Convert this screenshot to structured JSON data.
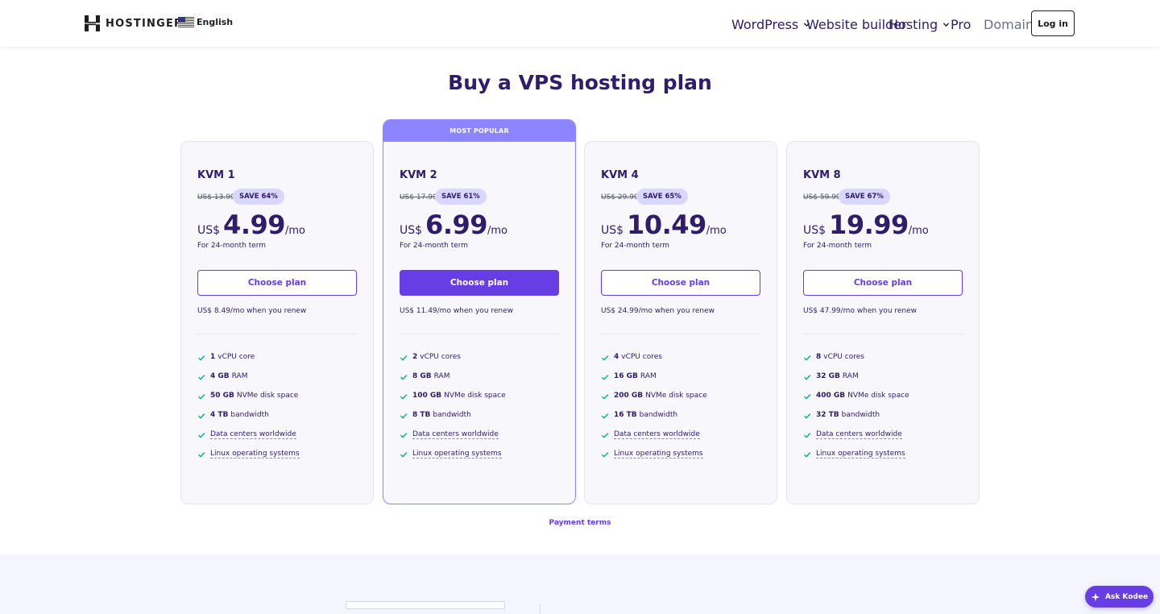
{
  "header": {
    "logo_text": "HOSTINGER",
    "language": "English",
    "nav": [
      {
        "label": "WordPress"
      },
      {
        "label": "Website builder"
      },
      {
        "label": "Hosting"
      },
      {
        "label": "Pro"
      },
      {
        "label": "Domains"
      }
    ],
    "login_label": "Log in"
  },
  "page_title": "Buy a VPS hosting plan",
  "popular_label": "MOST POPULAR",
  "plans": [
    {
      "name": "KVM 1",
      "old_price": "US$ 13.99",
      "save": "SAVE 64%",
      "currency": "US$",
      "price": "4.99",
      "per": "/mo",
      "term": "For 24-month term",
      "button": "Choose plan",
      "renew": "US$ 8.49/mo when you renew",
      "features": [
        {
          "bold": "1",
          "text": "vCPU core"
        },
        {
          "bold": "4 GB",
          "text": "RAM"
        },
        {
          "bold": "50 GB",
          "text": "NVMe disk space"
        },
        {
          "bold": "4 TB",
          "text": "bandwidth"
        },
        {
          "bold": "",
          "text": "Data centers worldwide"
        },
        {
          "bold": "",
          "text": "Linux operating systems"
        }
      ]
    },
    {
      "name": "KVM 2",
      "old_price": "US$ 17.99",
      "save": "SAVE 61%",
      "currency": "US$",
      "price": "6.99",
      "per": "/mo",
      "term": "For 24-month term",
      "button": "Choose plan",
      "renew": "US$ 11.49/mo when you renew",
      "features": [
        {
          "bold": "2",
          "text": "vCPU cores"
        },
        {
          "bold": "8 GB",
          "text": "RAM"
        },
        {
          "bold": "100 GB",
          "text": "NVMe disk space"
        },
        {
          "bold": "8 TB",
          "text": "bandwidth"
        },
        {
          "bold": "",
          "text": "Data centers worldwide"
        },
        {
          "bold": "",
          "text": "Linux operating systems"
        }
      ]
    },
    {
      "name": "KVM 4",
      "old_price": "US$ 29.99",
      "save": "SAVE 65%",
      "currency": "US$",
      "price": "10.49",
      "per": "/mo",
      "term": "For 24-month term",
      "button": "Choose plan",
      "renew": "US$ 24.99/mo when you renew",
      "features": [
        {
          "bold": "4",
          "text": "vCPU cores"
        },
        {
          "bold": "16 GB",
          "text": "RAM"
        },
        {
          "bold": "200 GB",
          "text": "NVMe disk space"
        },
        {
          "bold": "16 TB",
          "text": "bandwidth"
        },
        {
          "bold": "",
          "text": "Data centers worldwide"
        },
        {
          "bold": "",
          "text": "Linux operating systems"
        }
      ]
    },
    {
      "name": "KVM 8",
      "old_price": "US$ 59.99",
      "save": "SAVE 67%",
      "currency": "US$",
      "price": "19.99",
      "per": "/mo",
      "term": "For 24-month term",
      "button": "Choose plan",
      "renew": "US$ 47.99/mo when you renew",
      "features": [
        {
          "bold": "8",
          "text": "vCPU cores"
        },
        {
          "bold": "32 GB",
          "text": "RAM"
        },
        {
          "bold": "400 GB",
          "text": "NVMe disk space"
        },
        {
          "bold": "32 TB",
          "text": "bandwidth"
        },
        {
          "bold": "",
          "text": "Data centers worldwide"
        },
        {
          "bold": "",
          "text": "Linux operating systems"
        }
      ]
    }
  ],
  "payment_terms": "Payment terms",
  "ask_kodee": "Ask Kodee",
  "colors": {
    "primary": "#673de6",
    "popular": "#8c85ff",
    "heading": "#2f1c6a",
    "check": "#00b090",
    "badge": "#dad7fe"
  },
  "icons": {
    "logo": "hostinger-logo-icon",
    "flag": "us-flag-icon",
    "chevron": "chevron-down-icon",
    "check": "check-icon",
    "kodee": "sparkle-icon"
  }
}
